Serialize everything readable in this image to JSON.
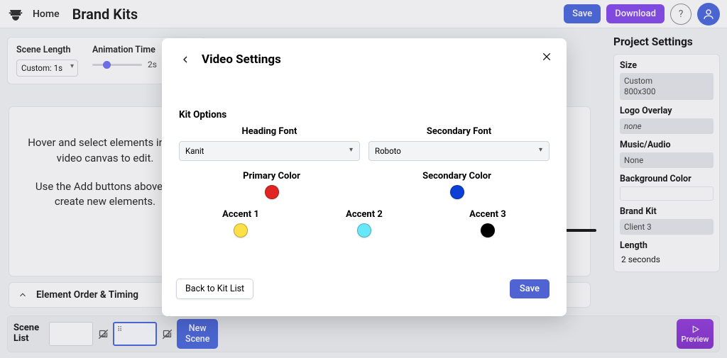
{
  "header": {
    "home": "Home",
    "title": "Brand Kits",
    "save": "Save",
    "download": "Download",
    "help": "?"
  },
  "scene_panel": {
    "length_label": "Scene Length",
    "length_value": "Custom: 1s",
    "anim_label": "Animation Time",
    "anim_value": "2s"
  },
  "canvas": {
    "hint1": "Hover and select elements in the video canvas to edit.",
    "hint2": "Use the Add buttons above to create new elements."
  },
  "element_order": {
    "label": "Element Order & Timing"
  },
  "right": {
    "title": "Project Settings",
    "size_label": "Size",
    "size_value1": "Custom",
    "size_value2": "800x300",
    "logo_label": "Logo Overlay",
    "logo_value": "none",
    "music_label": "Music/Audio",
    "music_value": "None",
    "bg_label": "Background Color",
    "kit_label": "Brand Kit",
    "kit_value": "Client 3",
    "length_label": "Length",
    "length_value": "2 seconds"
  },
  "bottom": {
    "scene_list": "Scene\nList",
    "new_scene": "New\nScene",
    "preview": "Preview"
  },
  "dialog": {
    "title": "Video Settings",
    "kit_options": "Kit Options",
    "heading_font_label": "Heading Font",
    "heading_font_value": "Kanit",
    "secondary_font_label": "Secondary Font",
    "secondary_font_value": "Roboto",
    "primary_color_label": "Primary Color",
    "primary_color": "#e02424",
    "secondary_color_label": "Secondary Color",
    "secondary_color": "#0b3fd6",
    "accent1_label": "Accent 1",
    "accent1": "#fde047",
    "accent2_label": "Accent 2",
    "accent2": "#67e8f9",
    "accent3_label": "Accent 3",
    "accent3": "#000000",
    "back": "Back to Kit List",
    "save": "Save"
  }
}
